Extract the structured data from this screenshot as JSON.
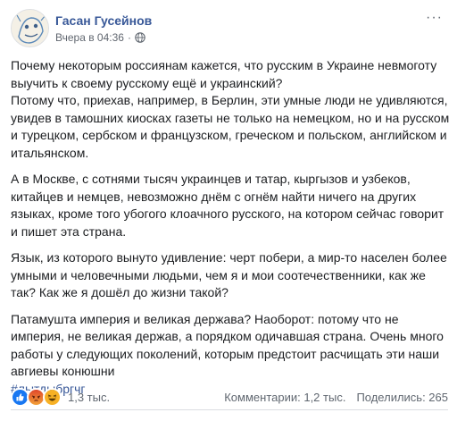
{
  "author": {
    "name": "Гасан Гусейнов",
    "timestamp": "Вчера в 04:36",
    "separator": "·",
    "privacy_icon": "globe-icon"
  },
  "menu": {
    "more_label": "···"
  },
  "post": {
    "paragraphs": [
      "Почему некоторым россиянам кажется, что русским в Украине невмоготу выучить к своему русскому ещё и украинский?\nПотому что, приехав, например, в Берлин, эти умные люди не удивляются, увидев в тамошних киосках газеты не только на немецком, но и на русском и турецком, сербском и французском, греческом и польском, английском и итальянском.",
      "А в Москве, с сотнями тысяч украинцев и татар, кыргызов и узбеков, китайцев и немцев, невозможно днём с огнём найти ничего на других языках, кроме того убогого клоачного русского, на котором сейчас говорит и пишет эта страна.",
      "Язык, из которого вынуто удивление: черт побери, а мир-то населен более умными и человечными людьми, чем я и мои соотечественники, как же так? Как же я дошёл до жизни такой?",
      "Патамушта империя и великая держава? Наоборот: потому что не империя, не великая держав, а порядком одичавшая страна. Очень много работы у следующих поколений, которым предстоит расчищать эти наши авгиевы конюшни"
    ],
    "hashtag": "#лытдыбргчг"
  },
  "footer": {
    "reaction_icons": [
      "like-icon",
      "angry-icon",
      "haha-icon"
    ],
    "reaction_count": "1,3 тыс.",
    "comments": "Комментарии: 1,2 тыс.",
    "shares": "Поделились: 265"
  },
  "colors": {
    "link": "#385898",
    "secondary_text": "#606770",
    "like": "#1877f2",
    "angry": "#e9710f",
    "haha": "#f7b125"
  }
}
